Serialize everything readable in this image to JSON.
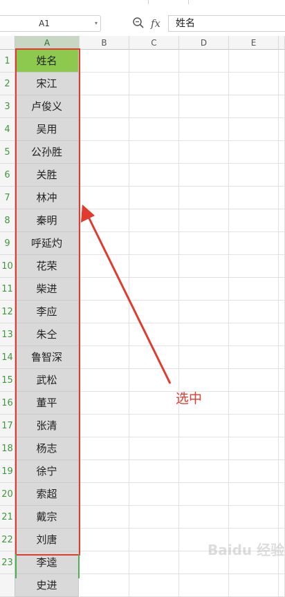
{
  "name_box": "A1",
  "formula_bar": {
    "zoom_icon": "zoom-icon",
    "fx_label": "fx",
    "value": "姓名"
  },
  "columns": [
    "A",
    "B",
    "C",
    "D",
    "E"
  ],
  "rows": [
    "1",
    "2",
    "3",
    "4",
    "5",
    "6",
    "7",
    "8",
    "9",
    "10",
    "11",
    "12",
    "13",
    "14",
    "15",
    "16",
    "17",
    "18",
    "19",
    "20",
    "21",
    "22",
    "23"
  ],
  "column_a": [
    "姓名",
    "宋江",
    "卢俊义",
    "吴用",
    "公孙胜",
    "关胜",
    "林冲",
    "秦明",
    "呼延灼",
    "花荣",
    "柴进",
    "李应",
    "朱仝",
    "鲁智深",
    "武松",
    "董平",
    "张清",
    "杨志",
    "徐宁",
    "索超",
    "戴宗",
    "刘唐",
    "李逵",
    "史进"
  ],
  "annotation": "选中",
  "watermark": "Baidu 经验",
  "colors": {
    "selection_border": "#e03b2e",
    "active_cell": "#8cc94e",
    "row_number": "#3c9a3c"
  }
}
